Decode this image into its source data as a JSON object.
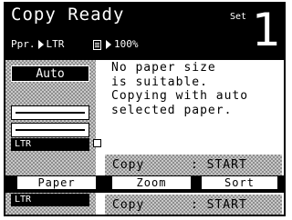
{
  "header": {
    "status": "Copy Ready",
    "set_label": "Set",
    "copy_count": "1",
    "paper_prefix": "Ppr.",
    "paper_value": "LTR",
    "zoom_value": "100%"
  },
  "sidebar": {
    "auto_label": "Auto",
    "tray_label": "LTR"
  },
  "message": {
    "lines": [
      "No paper size",
      "is suitable.",
      "Copying with auto",
      "selected paper."
    ]
  },
  "copy_rows": [
    {
      "label": "Copy",
      "value": ": START"
    },
    {
      "label": "Copy",
      "value": ": START"
    }
  ],
  "tabs": [
    "Paper",
    "Zoom",
    "Sort"
  ]
}
